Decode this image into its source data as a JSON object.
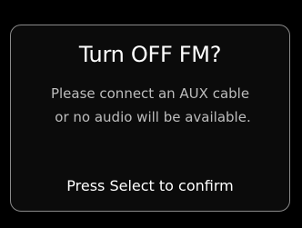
{
  "dialog": {
    "title": "Turn OFF FM?",
    "message_lines": [
      "Please connect an AUX cable",
      "or no audio will be available."
    ],
    "footer_hint": "Press Select to confirm"
  },
  "colors": {
    "background": "#000000",
    "border": "#8a8a8a",
    "title_text": "#ffffff",
    "message_text": "#bdbdbd"
  }
}
